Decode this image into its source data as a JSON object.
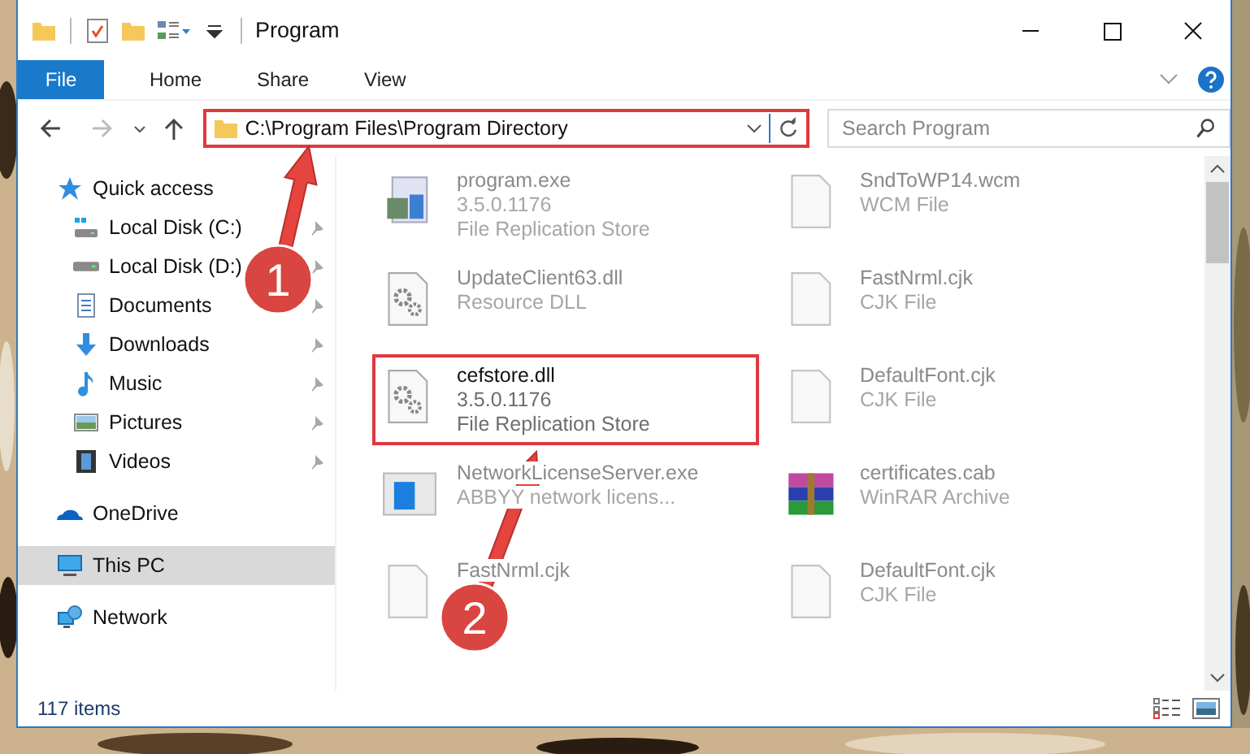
{
  "window": {
    "title": "Program"
  },
  "ribbon_tabs": [
    {
      "label": "File",
      "kind": "file"
    },
    {
      "label": "Home",
      "kind": "tab"
    },
    {
      "label": "Share",
      "kind": "tab"
    },
    {
      "label": "View",
      "kind": "tab"
    }
  ],
  "address_bar": {
    "path": "C:\\Program Files\\Program Directory",
    "highlighted": true
  },
  "search": {
    "placeholder": "Search Program"
  },
  "sidebar": {
    "items": [
      {
        "label": "Quick access",
        "kind": "star",
        "selected": false,
        "children": [
          {
            "label": "Local Disk (C:)",
            "kind": "drive-win",
            "pinned": true,
            "selected": false
          },
          {
            "label": "Local Disk (D:)",
            "kind": "drive",
            "pinned": true,
            "selected": false
          },
          {
            "label": "Documents",
            "kind": "documents",
            "pinned": true,
            "selected": false
          },
          {
            "label": "Downloads",
            "kind": "downloads",
            "pinned": true,
            "selected": false
          },
          {
            "label": "Music",
            "kind": "music",
            "pinned": true,
            "selected": false
          },
          {
            "label": "Pictures",
            "kind": "pictures",
            "pinned": true,
            "selected": false
          },
          {
            "label": "Videos",
            "kind": "videos",
            "pinned": true,
            "selected": false
          }
        ]
      },
      {
        "label": "OneDrive",
        "kind": "cloud",
        "selected": false
      },
      {
        "label": "This PC",
        "kind": "pc",
        "selected": true
      },
      {
        "label": "Network",
        "kind": "network",
        "selected": false
      }
    ]
  },
  "files": [
    {
      "name": "program.exe",
      "lines": [
        "3.5.0.1176",
        "File Replication Store"
      ],
      "kind": "app",
      "blurred": true,
      "highlighted": false
    },
    {
      "name": "SndToWP14.wcm",
      "lines": [
        "WCM File"
      ],
      "kind": "blank",
      "blurred": true,
      "highlighted": false
    },
    {
      "name": "UpdateClient63.dll",
      "lines": [
        "Resource DLL"
      ],
      "kind": "gear",
      "blurred": true,
      "highlighted": false
    },
    {
      "name": "FastNrml.cjk",
      "lines": [
        "CJK File"
      ],
      "kind": "blank",
      "blurred": true,
      "highlighted": false
    },
    {
      "name": "cefstore.dll",
      "lines": [
        "3.5.0.1176",
        "File Replication Store"
      ],
      "kind": "gear",
      "blurred": false,
      "highlighted": true
    },
    {
      "name": "DefaultFont.cjk",
      "lines": [
        "CJK File"
      ],
      "kind": "blank",
      "blurred": true,
      "highlighted": false
    },
    {
      "name": "NetworkLicenseServer.exe",
      "lines": [
        "ABBYY network licens..."
      ],
      "kind": "window",
      "blurred": true,
      "highlighted": false
    },
    {
      "name": "certificates.cab",
      "lines": [
        "WinRAR Archive"
      ],
      "kind": "archive",
      "blurred": true,
      "highlighted": false
    },
    {
      "name": "FastNrml.cjk",
      "kind": "blank",
      "blurred": true,
      "highlighted": false
    },
    {
      "name": "DefaultFont.cjk",
      "lines": [
        "CJK File"
      ],
      "kind": "blank",
      "blurred": true,
      "highlighted": false
    }
  ],
  "status_bar": {
    "item_count": "117 items"
  },
  "annotations": [
    {
      "number": "1"
    },
    {
      "number": "2"
    }
  ]
}
